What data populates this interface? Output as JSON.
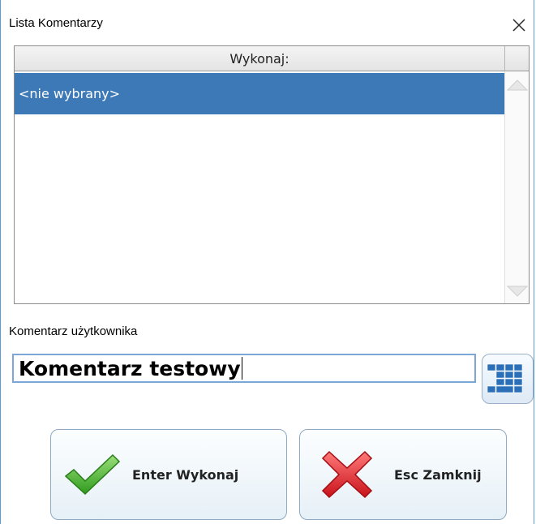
{
  "window": {
    "title": "Lista Komentarzy",
    "close_glyph": "✕"
  },
  "list": {
    "header": "Wykonaj:",
    "items": [
      {
        "label": "<nie wybrany>",
        "selected": true
      }
    ]
  },
  "comment": {
    "label": "Komentarz użytkownika",
    "value": "Komentarz testowy"
  },
  "buttons": {
    "ok_label": "Enter Wykonaj",
    "cancel_label": "Esc Zamknij"
  },
  "icons": {
    "ok": "checkmark-icon",
    "cancel": "red-x-icon",
    "keyboard": "keyboard-icon"
  },
  "colors": {
    "selection": "#3d79b6",
    "ok_green": "#3fae2a",
    "cancel_red": "#e0262a",
    "window_border": "#5b9bd5"
  }
}
